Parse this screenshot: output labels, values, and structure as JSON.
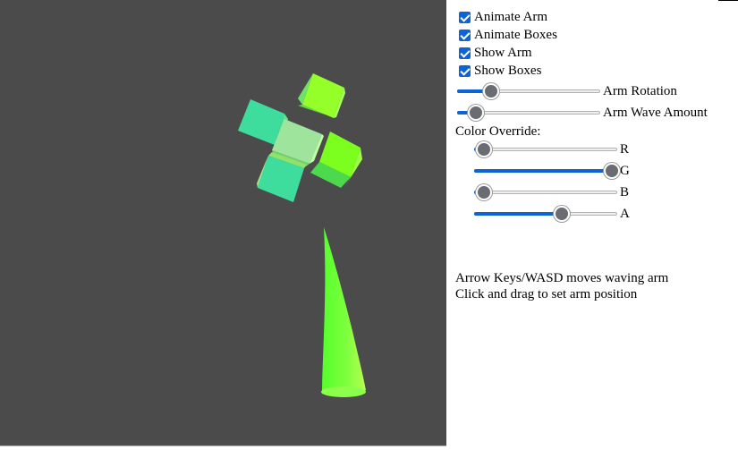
{
  "controls": {
    "checkboxes": [
      {
        "label": "Animate Arm",
        "checked": true
      },
      {
        "label": "Animate Boxes",
        "checked": true
      },
      {
        "label": "Show Arm",
        "checked": true
      },
      {
        "label": "Show Boxes",
        "checked": true
      }
    ],
    "arm_rotation": {
      "label": "Arm Rotation",
      "value": 0.24
    },
    "arm_wave_amount": {
      "label": "Arm Wave Amount",
      "value": 0.13
    },
    "color_override": {
      "title": "Color Override:",
      "channels": [
        {
          "label": "R",
          "value": 0.07
        },
        {
          "label": "G",
          "value": 0.96
        },
        {
          "label": "B",
          "value": 0.07
        },
        {
          "label": "A",
          "value": 0.61
        }
      ]
    }
  },
  "hints": {
    "line1": "Arrow Keys/WASD moves waving arm",
    "line2": "Click and drag to set arm position"
  },
  "colors": {
    "viewport_bg": "#4b4b4b",
    "accent": "#0b64d8",
    "thumb": "#6a6c74",
    "box_teal": "#3ddc9c",
    "box_lime": "#8cff1e",
    "box_pale": "#9be39a",
    "arm_green": "#6cff3a"
  }
}
